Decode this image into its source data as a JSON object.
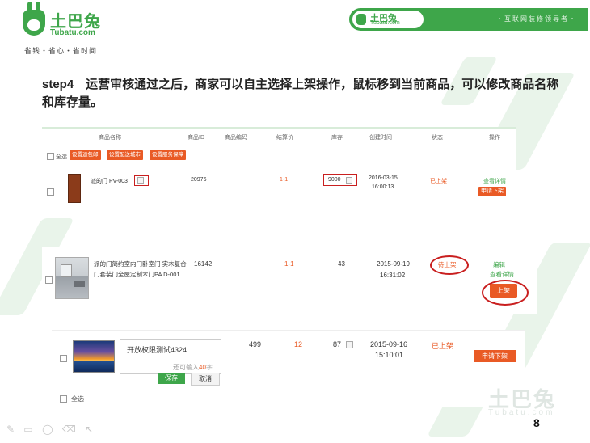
{
  "logo": {
    "name_cn": "土巴兔",
    "name_en": "Tubatu.com",
    "slogan": "省钱・省心・省时间"
  },
  "banner": {
    "logo_cn": "土巴兔",
    "logo_en": "Tubatu.com",
    "tagline": "・互联网装修领导者・"
  },
  "heading": "step4　运营审核通过之后，商家可以自主选择上架操作，鼠标移到当前商品，可以修改商品名称和库存量。",
  "table": {
    "headers": [
      "商品名称",
      "商品ID",
      "商品编码",
      "结算价",
      "库存",
      "创建时间",
      "状态",
      "操作"
    ],
    "select_all": "全选",
    "bulk_buttons": [
      "设置运包邮",
      "设置配送城市",
      "设置服务保障"
    ]
  },
  "row1": {
    "name": "派的门 PV-003",
    "id": "20976",
    "price": "1-1",
    "stock": "9000",
    "date": "2016-03-15",
    "time": "16:00:13",
    "status": "已上架",
    "view": "查看详情",
    "apply": "申请下架"
  },
  "row2": {
    "name": "派的门简约室内门卧室门 实木复合门套装门全屋定制木门PA D-001",
    "id": "16142",
    "price": "1-1",
    "stock": "43",
    "date": "2015-09-19",
    "time": "16:31:02",
    "status": "待上架",
    "edit": "编辑",
    "view": "查看详情",
    "shelf": "上架"
  },
  "row3": {
    "name": "开放权限测试4324",
    "hint_prefix": "还可输入",
    "hint_count": "40",
    "hint_suffix": "字",
    "save": "保存",
    "cancel": "取消",
    "id": "499",
    "price": "12",
    "stock": "87",
    "date": "2015-09-16",
    "time": "15:10:01",
    "status": "已上架",
    "apply": "申请下架",
    "select_all": "全选"
  },
  "watermark": {
    "cn": "土巴兔",
    "en": "Tubatu.com"
  },
  "page_number": "8"
}
